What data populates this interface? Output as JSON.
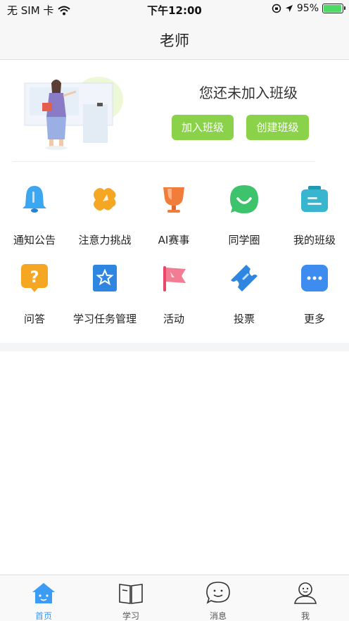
{
  "status_bar": {
    "carrier": "无 SIM 卡",
    "time": "下午12:00",
    "battery": "95%",
    "battery_level": 0.95
  },
  "nav": {
    "title": "老师"
  },
  "banner": {
    "message": "您还未加入班级",
    "join_button": "加入班级",
    "create_button": "创建班级"
  },
  "grid": {
    "items": [
      {
        "label": "通知公告",
        "icon": "bell-icon"
      },
      {
        "label": "注意力挑战",
        "icon": "puzzle-icon"
      },
      {
        "label": "AI赛事",
        "icon": "trophy-icon"
      },
      {
        "label": "同学圈",
        "icon": "chat-bubble-icon"
      },
      {
        "label": "我的班级",
        "icon": "class-board-icon"
      },
      {
        "label": "问答",
        "icon": "question-icon"
      },
      {
        "label": "学习任务管理",
        "icon": "star-bookmark-icon"
      },
      {
        "label": "活动",
        "icon": "flag-icon"
      },
      {
        "label": "投票",
        "icon": "ticket-icon"
      },
      {
        "label": "更多",
        "icon": "more-icon"
      }
    ]
  },
  "tab_bar": {
    "tabs": [
      {
        "label": "首页",
        "icon": "home-icon",
        "active": true
      },
      {
        "label": "学习",
        "icon": "book-icon",
        "active": false
      },
      {
        "label": "消息",
        "icon": "message-icon",
        "active": false
      },
      {
        "label": "我",
        "icon": "profile-icon",
        "active": false
      }
    ]
  },
  "colors": {
    "accent_green": "#8bd24b",
    "tab_active": "#3b9bf5"
  }
}
